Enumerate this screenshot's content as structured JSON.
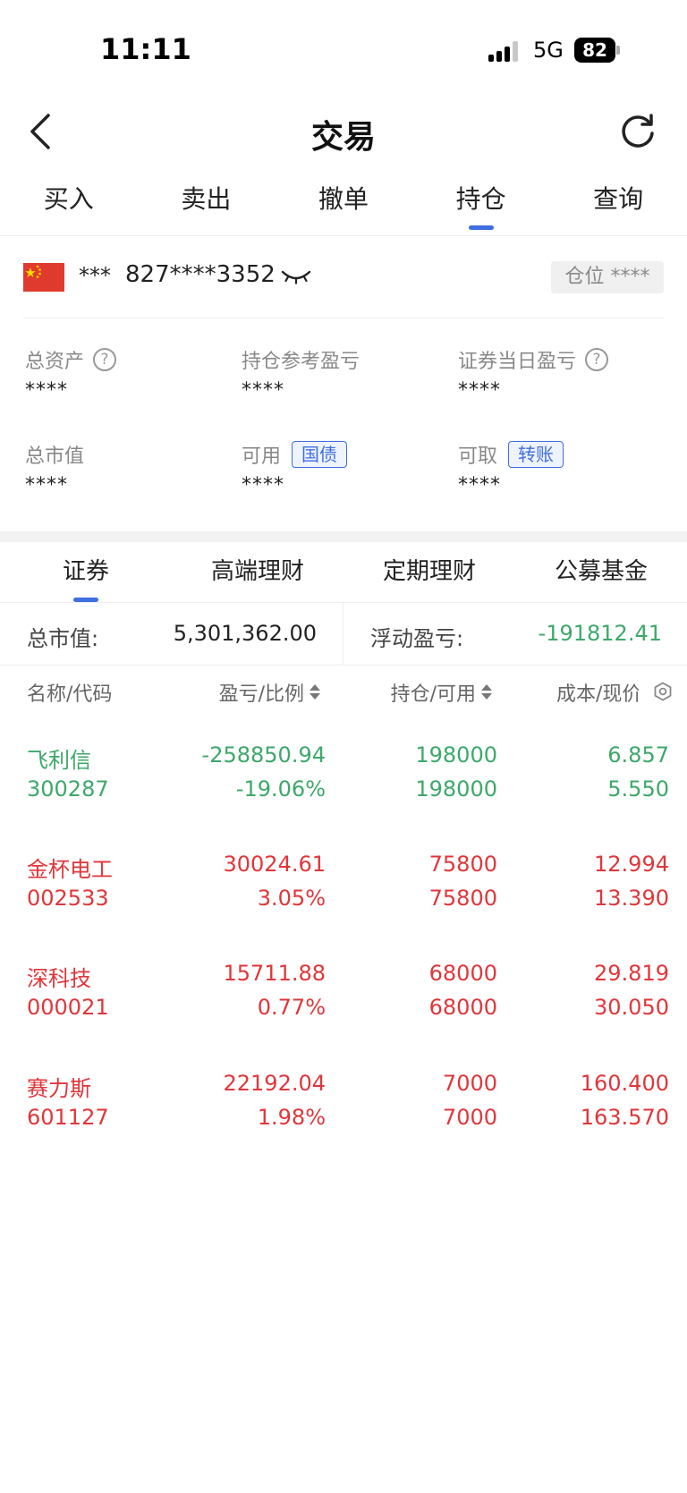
{
  "status_bar": {
    "time": "11:11",
    "network": "5G",
    "battery": "82"
  },
  "header": {
    "title": "交易"
  },
  "top_tabs": [
    {
      "label": "买入",
      "active": false
    },
    {
      "label": "卖出",
      "active": false
    },
    {
      "label": "撤单",
      "active": false
    },
    {
      "label": "持仓",
      "active": true
    },
    {
      "label": "查询",
      "active": false
    }
  ],
  "account": {
    "name_mask": "***",
    "number": "827****3352",
    "position_badge": "仓位 ****"
  },
  "summary": {
    "total_assets": {
      "label": "总资产",
      "value": "****"
    },
    "position_pnl": {
      "label": "持仓参考盈亏",
      "value": "****"
    },
    "daily_pnl": {
      "label": "证券当日盈亏",
      "value": "****"
    },
    "market_value": {
      "label": "总市值",
      "value": "****"
    },
    "available": {
      "label": "可用",
      "tag": "国债",
      "value": "****"
    },
    "withdrawable": {
      "label": "可取",
      "tag": "转账",
      "value": "****"
    }
  },
  "product_tabs": [
    {
      "label": "证券",
      "active": true
    },
    {
      "label": "高端理财",
      "active": false
    },
    {
      "label": "定期理财",
      "active": false
    },
    {
      "label": "公募基金",
      "active": false
    }
  ],
  "totals": {
    "market_value_label": "总市值:",
    "market_value": "5,301,362.00",
    "floating_pnl_label": "浮动盈亏:",
    "floating_pnl": "-191812.41"
  },
  "table": {
    "headers": [
      "名称/代码",
      "盈亏/比例",
      "持仓/可用",
      "成本/现价"
    ],
    "rows": [
      {
        "name": "飞利信",
        "code": "300287",
        "pnl": "-258850.94",
        "ratio": "-19.06%",
        "holding": "198000",
        "available": "198000",
        "cost": "6.857",
        "price": "5.550",
        "trend": "down"
      },
      {
        "name": "金杯电工",
        "code": "002533",
        "pnl": "30024.61",
        "ratio": "3.05%",
        "holding": "75800",
        "available": "75800",
        "cost": "12.994",
        "price": "13.390",
        "trend": "up"
      },
      {
        "name": "深科技",
        "code": "000021",
        "pnl": "15711.88",
        "ratio": "0.77%",
        "holding": "68000",
        "available": "68000",
        "cost": "29.819",
        "price": "30.050",
        "trend": "up"
      },
      {
        "name": "赛力斯",
        "code": "601127",
        "pnl": "22192.04",
        "ratio": "1.98%",
        "holding": "7000",
        "available": "7000",
        "cost": "160.400",
        "price": "163.570",
        "trend": "up"
      }
    ]
  },
  "colors": {
    "accent": "#3e6ee0",
    "up": "#e0363a",
    "down": "#3da86a"
  }
}
